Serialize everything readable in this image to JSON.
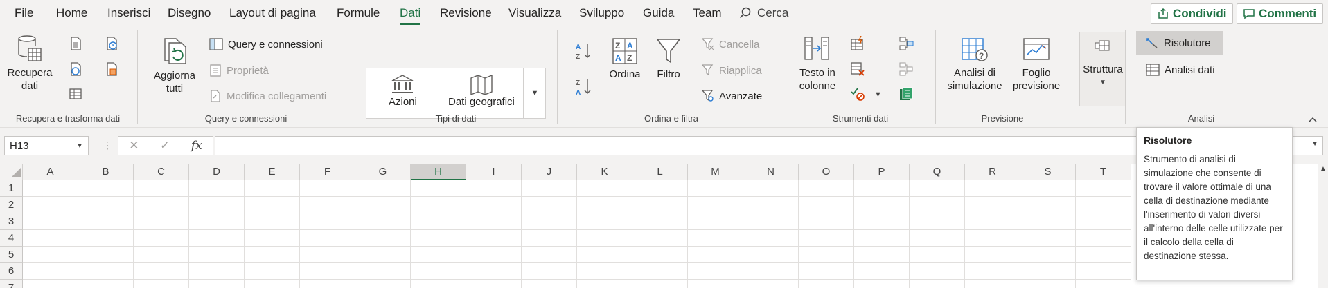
{
  "menu": {
    "file": "File",
    "home": "Home",
    "insert": "Inserisci",
    "draw": "Disegno",
    "layout": "Layout di pagina",
    "formulas": "Formule",
    "data": "Dati",
    "review": "Revisione",
    "view": "Visualizza",
    "developer": "Sviluppo",
    "help": "Guida",
    "team": "Team",
    "search": "Cerca",
    "share": "Condividi",
    "comments": "Commenti"
  },
  "ribbon": {
    "get_data": "Recupera",
    "get_data2": "dati",
    "group1": "Recupera e trasforma dati",
    "refresh": "Aggiorna",
    "refresh2": "tutti",
    "queries": "Query e connessioni",
    "properties": "Proprietà",
    "edit_links": "Modifica collegamenti",
    "group2": "Query e connessioni",
    "stocks": "Azioni",
    "geography": "Dati geografici",
    "group3": "Tipi di dati",
    "sort": "Ordina",
    "filter": "Filtro",
    "clear": "Cancella",
    "reapply": "Riapplica",
    "advanced": "Avanzate",
    "group4": "Ordina e filtra",
    "text_to_columns": "Testo in",
    "text_to_columns2": "colonne",
    "group5": "Strumenti dati",
    "whatif": "Analisi di",
    "whatif2": "simulazione",
    "forecast": "Foglio",
    "forecast2": "previsione",
    "group6": "Previsione",
    "outline": "Struttura",
    "solver": "Risolutore",
    "data_analysis": "Analisi dati",
    "group7": "Analisi"
  },
  "formula_bar": {
    "namebox": "H13",
    "fx": "fx"
  },
  "columns": [
    "A",
    "B",
    "C",
    "D",
    "E",
    "F",
    "G",
    "H",
    "I",
    "J",
    "K",
    "L",
    "M",
    "N",
    "O",
    "P",
    "Q",
    "R",
    "S",
    "T"
  ],
  "rows": [
    "1",
    "2",
    "3",
    "4",
    "5",
    "6",
    "7"
  ],
  "tooltip": {
    "title": "Risolutore",
    "body": "Strumento di analisi di simulazione che consente di trovare il valore ottimale di una cella di destinazione mediante l'inserimento di valori diversi all'interno delle celle utilizzate per il calcolo della cella di destinazione stessa."
  },
  "colors": {
    "accent": "#217346"
  }
}
